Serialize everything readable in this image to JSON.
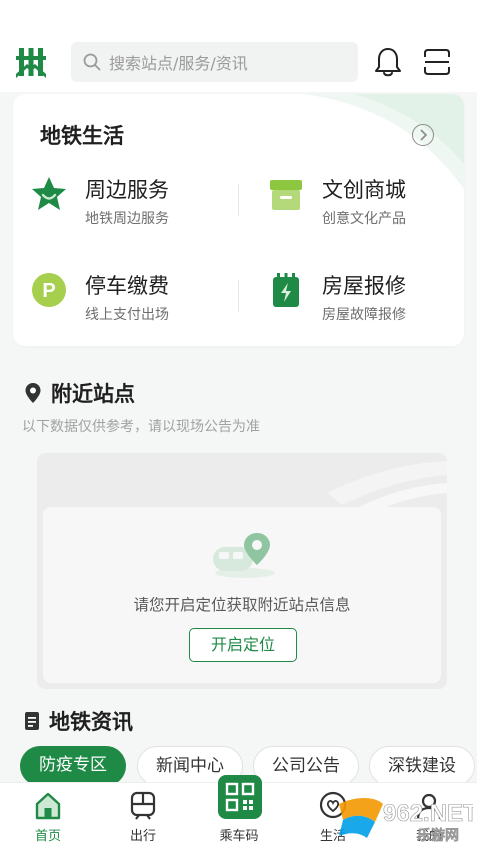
{
  "header": {
    "logo": "shenzhen-metro-logo",
    "search_placeholder": "搜索站点/服务/资讯"
  },
  "life": {
    "title": "地铁生活",
    "services": [
      {
        "name": "周边服务",
        "desc": "地铁周边服务",
        "icon": "star-smile-icon"
      },
      {
        "name": "文创商城",
        "desc": "创意文化产品",
        "icon": "shop-icon"
      },
      {
        "name": "停车缴费",
        "desc": "线上支付出场",
        "icon": "parking-icon"
      },
      {
        "name": "房屋报修",
        "desc": "房屋故障报修",
        "icon": "repair-battery-icon"
      }
    ]
  },
  "nearby": {
    "title": "附近站点",
    "subtitle": "以下数据仅供参考，请以现场公告为准",
    "message": "请您开启定位获取附近站点信息",
    "button": "开启定位"
  },
  "news": {
    "title": "地铁资讯",
    "tabs": [
      "防疫专区",
      "新闻中心",
      "公司公告",
      "深铁建设"
    ],
    "active_tab": 0
  },
  "bottom_nav": {
    "items": [
      {
        "label": "首页",
        "icon": "home-icon",
        "active": true
      },
      {
        "label": "出行",
        "icon": "train-icon",
        "active": false
      },
      {
        "label": "乘车码",
        "icon": "qr-code-icon",
        "active": false
      },
      {
        "label": "生活",
        "icon": "heart-icon",
        "active": false
      },
      {
        "label": "我的",
        "icon": "user-icon",
        "active": false
      }
    ]
  },
  "watermark": {
    "text": "962.NET",
    "subtext": "乐游网"
  },
  "colors": {
    "primary": "#1f8a45",
    "light_green": "#8dc63f",
    "background": "#f5f6f6"
  }
}
